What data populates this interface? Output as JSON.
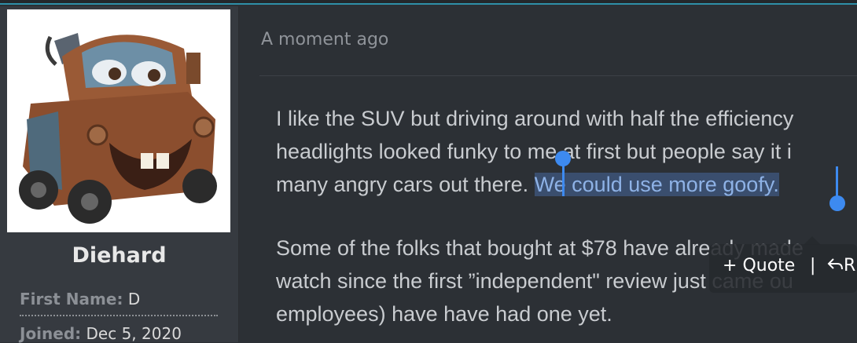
{
  "user": {
    "avatar_alt": "Tow truck avatar",
    "name": "Diehard",
    "first_name_label": "First Name:",
    "first_name_value": "D",
    "joined_label": "Joined:",
    "joined_value": "Dec 5, 2020"
  },
  "post": {
    "timestamp": "A moment ago",
    "para1": {
      "line1": "I like the SUV but driving around with half the efficiency",
      "line2": "headlights looked funky to me at first but people say it i",
      "line3_before": "many angry cars out there. ",
      "line3_selected": "We could use more goofy."
    },
    "para2": {
      "line1": "Some of the folks that bought at $78 have already made",
      "line2": "watch since the first ”independent\" review just came ou",
      "line3": "employees) have have had one yet."
    }
  },
  "selection_popup": {
    "quote_icon": "+",
    "quote_label": "Quote",
    "separator": "|",
    "reply_icon": "reply-icon",
    "reply_label": "R"
  },
  "colors": {
    "accent_line": "#2e8fa8",
    "selection_handle": "#3d8af0",
    "selection_bg": "#3a4e6e"
  }
}
